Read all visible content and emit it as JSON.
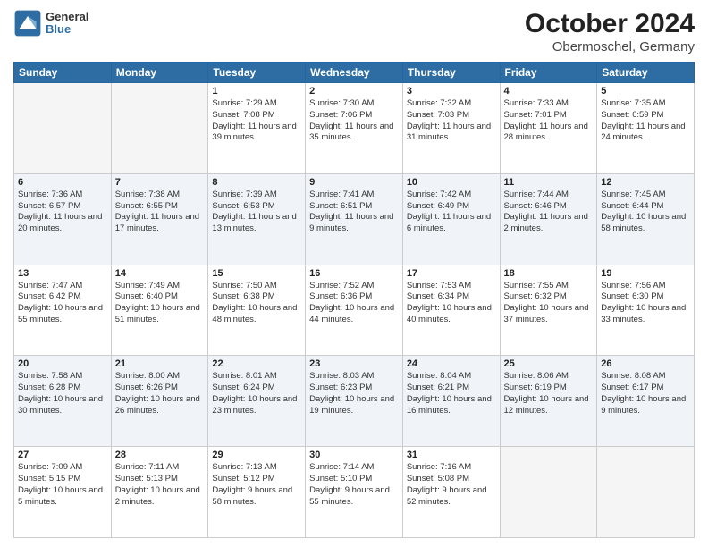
{
  "logo": {
    "text1": "General",
    "text2": "Blue"
  },
  "title": "October 2024",
  "subtitle": "Obermoschel, Germany",
  "weekdays": [
    "Sunday",
    "Monday",
    "Tuesday",
    "Wednesday",
    "Thursday",
    "Friday",
    "Saturday"
  ],
  "weeks": [
    [
      {
        "day": "",
        "sunrise": "",
        "sunset": "",
        "daylight": "",
        "empty": true
      },
      {
        "day": "",
        "sunrise": "",
        "sunset": "",
        "daylight": "",
        "empty": true
      },
      {
        "day": "1",
        "sunrise": "Sunrise: 7:29 AM",
        "sunset": "Sunset: 7:08 PM",
        "daylight": "Daylight: 11 hours and 39 minutes."
      },
      {
        "day": "2",
        "sunrise": "Sunrise: 7:30 AM",
        "sunset": "Sunset: 7:06 PM",
        "daylight": "Daylight: 11 hours and 35 minutes."
      },
      {
        "day": "3",
        "sunrise": "Sunrise: 7:32 AM",
        "sunset": "Sunset: 7:03 PM",
        "daylight": "Daylight: 11 hours and 31 minutes."
      },
      {
        "day": "4",
        "sunrise": "Sunrise: 7:33 AM",
        "sunset": "Sunset: 7:01 PM",
        "daylight": "Daylight: 11 hours and 28 minutes."
      },
      {
        "day": "5",
        "sunrise": "Sunrise: 7:35 AM",
        "sunset": "Sunset: 6:59 PM",
        "daylight": "Daylight: 11 hours and 24 minutes."
      }
    ],
    [
      {
        "day": "6",
        "sunrise": "Sunrise: 7:36 AM",
        "sunset": "Sunset: 6:57 PM",
        "daylight": "Daylight: 11 hours and 20 minutes."
      },
      {
        "day": "7",
        "sunrise": "Sunrise: 7:38 AM",
        "sunset": "Sunset: 6:55 PM",
        "daylight": "Daylight: 11 hours and 17 minutes."
      },
      {
        "day": "8",
        "sunrise": "Sunrise: 7:39 AM",
        "sunset": "Sunset: 6:53 PM",
        "daylight": "Daylight: 11 hours and 13 minutes."
      },
      {
        "day": "9",
        "sunrise": "Sunrise: 7:41 AM",
        "sunset": "Sunset: 6:51 PM",
        "daylight": "Daylight: 11 hours and 9 minutes."
      },
      {
        "day": "10",
        "sunrise": "Sunrise: 7:42 AM",
        "sunset": "Sunset: 6:49 PM",
        "daylight": "Daylight: 11 hours and 6 minutes."
      },
      {
        "day": "11",
        "sunrise": "Sunrise: 7:44 AM",
        "sunset": "Sunset: 6:46 PM",
        "daylight": "Daylight: 11 hours and 2 minutes."
      },
      {
        "day": "12",
        "sunrise": "Sunrise: 7:45 AM",
        "sunset": "Sunset: 6:44 PM",
        "daylight": "Daylight: 10 hours and 58 minutes."
      }
    ],
    [
      {
        "day": "13",
        "sunrise": "Sunrise: 7:47 AM",
        "sunset": "Sunset: 6:42 PM",
        "daylight": "Daylight: 10 hours and 55 minutes."
      },
      {
        "day": "14",
        "sunrise": "Sunrise: 7:49 AM",
        "sunset": "Sunset: 6:40 PM",
        "daylight": "Daylight: 10 hours and 51 minutes."
      },
      {
        "day": "15",
        "sunrise": "Sunrise: 7:50 AM",
        "sunset": "Sunset: 6:38 PM",
        "daylight": "Daylight: 10 hours and 48 minutes."
      },
      {
        "day": "16",
        "sunrise": "Sunrise: 7:52 AM",
        "sunset": "Sunset: 6:36 PM",
        "daylight": "Daylight: 10 hours and 44 minutes."
      },
      {
        "day": "17",
        "sunrise": "Sunrise: 7:53 AM",
        "sunset": "Sunset: 6:34 PM",
        "daylight": "Daylight: 10 hours and 40 minutes."
      },
      {
        "day": "18",
        "sunrise": "Sunrise: 7:55 AM",
        "sunset": "Sunset: 6:32 PM",
        "daylight": "Daylight: 10 hours and 37 minutes."
      },
      {
        "day": "19",
        "sunrise": "Sunrise: 7:56 AM",
        "sunset": "Sunset: 6:30 PM",
        "daylight": "Daylight: 10 hours and 33 minutes."
      }
    ],
    [
      {
        "day": "20",
        "sunrise": "Sunrise: 7:58 AM",
        "sunset": "Sunset: 6:28 PM",
        "daylight": "Daylight: 10 hours and 30 minutes."
      },
      {
        "day": "21",
        "sunrise": "Sunrise: 8:00 AM",
        "sunset": "Sunset: 6:26 PM",
        "daylight": "Daylight: 10 hours and 26 minutes."
      },
      {
        "day": "22",
        "sunrise": "Sunrise: 8:01 AM",
        "sunset": "Sunset: 6:24 PM",
        "daylight": "Daylight: 10 hours and 23 minutes."
      },
      {
        "day": "23",
        "sunrise": "Sunrise: 8:03 AM",
        "sunset": "Sunset: 6:23 PM",
        "daylight": "Daylight: 10 hours and 19 minutes."
      },
      {
        "day": "24",
        "sunrise": "Sunrise: 8:04 AM",
        "sunset": "Sunset: 6:21 PM",
        "daylight": "Daylight: 10 hours and 16 minutes."
      },
      {
        "day": "25",
        "sunrise": "Sunrise: 8:06 AM",
        "sunset": "Sunset: 6:19 PM",
        "daylight": "Daylight: 10 hours and 12 minutes."
      },
      {
        "day": "26",
        "sunrise": "Sunrise: 8:08 AM",
        "sunset": "Sunset: 6:17 PM",
        "daylight": "Daylight: 10 hours and 9 minutes."
      }
    ],
    [
      {
        "day": "27",
        "sunrise": "Sunrise: 7:09 AM",
        "sunset": "Sunset: 5:15 PM",
        "daylight": "Daylight: 10 hours and 5 minutes."
      },
      {
        "day": "28",
        "sunrise": "Sunrise: 7:11 AM",
        "sunset": "Sunset: 5:13 PM",
        "daylight": "Daylight: 10 hours and 2 minutes."
      },
      {
        "day": "29",
        "sunrise": "Sunrise: 7:13 AM",
        "sunset": "Sunset: 5:12 PM",
        "daylight": "Daylight: 9 hours and 58 minutes."
      },
      {
        "day": "30",
        "sunrise": "Sunrise: 7:14 AM",
        "sunset": "Sunset: 5:10 PM",
        "daylight": "Daylight: 9 hours and 55 minutes."
      },
      {
        "day": "31",
        "sunrise": "Sunrise: 7:16 AM",
        "sunset": "Sunset: 5:08 PM",
        "daylight": "Daylight: 9 hours and 52 minutes."
      },
      {
        "day": "",
        "sunrise": "",
        "sunset": "",
        "daylight": "",
        "empty": true
      },
      {
        "day": "",
        "sunrise": "",
        "sunset": "",
        "daylight": "",
        "empty": true
      }
    ]
  ]
}
